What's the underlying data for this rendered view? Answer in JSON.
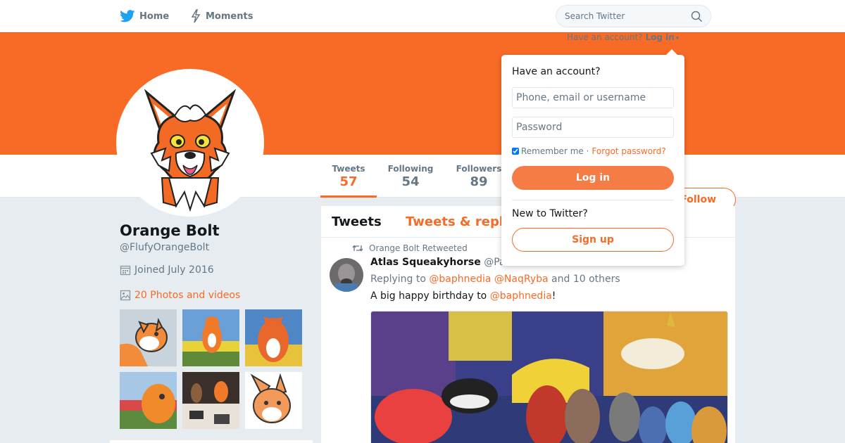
{
  "topnav": {
    "home_label": "Home",
    "moments_label": "Moments",
    "search_placeholder": "Search Twitter"
  },
  "login_prompt": {
    "text": "Have an account?",
    "link": "Log in"
  },
  "profile": {
    "name": "Orange Bolt",
    "handle": "@FlufyOrangeBolt",
    "joined": "Joined July 2016",
    "photos_link": "20 Photos and videos"
  },
  "stats": [
    {
      "label": "Tweets",
      "value": "57"
    },
    {
      "label": "Following",
      "value": "54"
    },
    {
      "label": "Followers",
      "value": "89"
    }
  ],
  "follow_button": "Follow",
  "timeline": {
    "tabs": [
      "Tweets",
      "Tweets & repl"
    ],
    "tweet": {
      "retweet_label": "Orange Bolt Retweeted",
      "author": "Atlas Squeakyhorse",
      "handle": "@Pa",
      "date": "",
      "replying_prefix": "Replying to",
      "mention_1": "@baphnedia",
      "mention_2": "@NaqRyba",
      "replying_suffix": "and 10 others",
      "text_prefix": "A big happy birthday to",
      "text_mention": "@baphnedia",
      "text_suffix": "!"
    }
  },
  "login_dropdown": {
    "title": "Have an account?",
    "username_placeholder": "Phone, email or username",
    "password_placeholder": "Password",
    "remember_label": "Remember me ·",
    "forgot_label": "Forgot password?",
    "login_button": "Log in",
    "new_label": "New to Twitter?",
    "signup_button": "Sign up"
  },
  "colors": {
    "accent": "#f76b26",
    "login_button": "#f57c44",
    "background": "#e6ecf0"
  },
  "icons": [
    "twitter-bird-icon",
    "moments-bolt-icon",
    "search-icon",
    "calendar-icon",
    "photo-icon",
    "retweet-icon",
    "caret-down-icon"
  ]
}
